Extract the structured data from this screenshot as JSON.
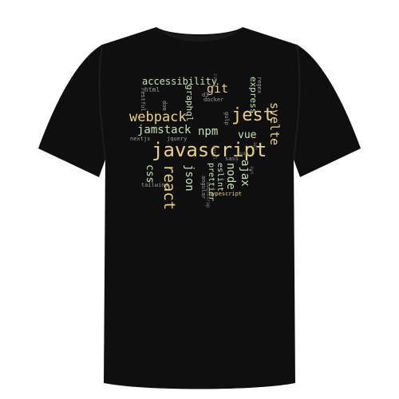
{
  "colors": {
    "background": "#ffffff",
    "shirt": "#0f0f0f",
    "shirt_shadow": "#1c1c1c",
    "collar": "#1a1a1a",
    "gold": "#e8d27a",
    "pale_green": "#c8e0b0",
    "gray": "#9a9a9a",
    "dim": "#7a7a7a"
  },
  "words": {
    "accessibility": "accessibility",
    "html": "html",
    "css_small": "css",
    "git": "git",
    "graphql": "graphql",
    "d3": "d3",
    "docker": "docker",
    "regex": "regex",
    "express": "express",
    "restful": "restful",
    "dom": "dom",
    "webpack": "webpack",
    "jest": "jest",
    "svelte": "svelte",
    "jamstack": "jamstack",
    "npm": "npm",
    "vue": "vue",
    "gulp": "gulp",
    "nextjs": "nextjs",
    "jquery": "jquery",
    "javascript": "javascript",
    "react": "react",
    "json": "json",
    "css": "css",
    "tailwind": "tailwind",
    "angular": "angular",
    "prettier": "prettier",
    "eslint": "eslint",
    "node": "node",
    "ajax": "ajax",
    "sass": "sass",
    "typescript": "typescript",
    "nosql": "nosql",
    "bootstrap": "bootstrap",
    "api": "api",
    "sql": "sql",
    "aws": "aws"
  }
}
